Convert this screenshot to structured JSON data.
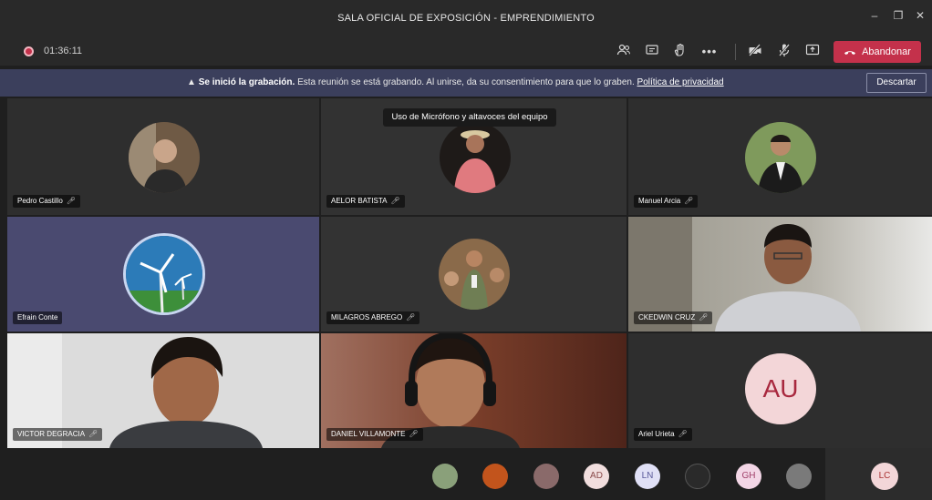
{
  "window": {
    "title": "SALA OFICIAL DE EXPOSICIÓN - EMPRENDIMIENTO",
    "minimize_glyph": "–",
    "maximize_glyph": "❐",
    "close_glyph": "✕"
  },
  "toolbar": {
    "timer": "01:36:11",
    "leave_label": "Abandonar",
    "icons": [
      "participants-icon",
      "chat-icon",
      "raise-hand-icon",
      "more-options-icon",
      "camera-off-icon",
      "mic-off-icon",
      "share-screen-icon"
    ]
  },
  "banner": {
    "bold": "Se inició la grabación.",
    "text": "Esta reunión se está grabando. Al unirse, da su consentimiento para que lo graben.",
    "link": "Política de privacidad",
    "dismiss_label": "Descartar"
  },
  "tooltip": "Uso de Micrófono y altavoces del equipo",
  "participants": [
    {
      "name": "Pedro Castillo"
    },
    {
      "name": "AELOR BATISTA"
    },
    {
      "name": "Manuel Arcia"
    },
    {
      "name": "Efrain Conte"
    },
    {
      "name": "MILAGROS ABREGO"
    },
    {
      "name": "CKEDWIN CRUZ"
    },
    {
      "name": "VICTOR DEGRACIA"
    },
    {
      "name": "DANIEL VILLAMONTE"
    },
    {
      "name": "Ariel Urieta",
      "initials": "AU"
    }
  ],
  "tray": {
    "initials": [
      "AD",
      "LN",
      "GH"
    ],
    "self_initials": "LC"
  },
  "colors": {
    "accent_red": "#c4314b",
    "banner_bg": "#3b3f5c",
    "initials_avatar_bg": "#f3d6d8"
  }
}
